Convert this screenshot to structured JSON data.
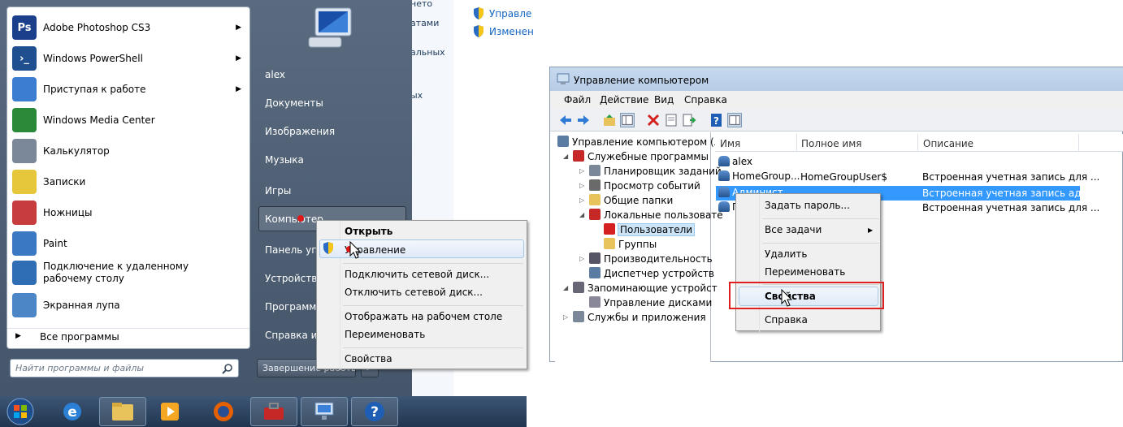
{
  "background_window": {
    "fragments": [
      "нето",
      "атами",
      "альных",
      "ых"
    ],
    "links": [
      "Управле",
      "Изменен"
    ]
  },
  "start_menu": {
    "programs": [
      {
        "label": "Adobe Photoshop CS3",
        "icon": "photoshop-icon",
        "has_submenu": true
      },
      {
        "label": "Windows PowerShell",
        "icon": "powershell-icon",
        "has_submenu": true
      },
      {
        "label": "Приступая к работе",
        "icon": "getting-started-icon",
        "has_submenu": true
      },
      {
        "label": "Windows Media Center",
        "icon": "media-center-icon",
        "has_submenu": false
      },
      {
        "label": "Калькулятор",
        "icon": "calculator-icon",
        "has_submenu": false
      },
      {
        "label": "Записки",
        "icon": "sticky-notes-icon",
        "has_submenu": false
      },
      {
        "label": "Ножницы",
        "icon": "snipping-tool-icon",
        "has_submenu": false
      },
      {
        "label": "Paint",
        "icon": "paint-icon",
        "has_submenu": false
      },
      {
        "label": "Подключение к удаленному рабочему столу",
        "icon": "remote-desktop-icon",
        "has_submenu": false
      },
      {
        "label": "Экранная лупа",
        "icon": "magnifier-icon",
        "has_submenu": false
      }
    ],
    "all_programs": "Все программы",
    "search_placeholder": "Найти программы и файлы",
    "right_items": [
      "alex",
      "Документы",
      "Изображения",
      "Музыка",
      "Игры",
      "Компьютер",
      "Панель упр",
      "Устройства",
      "Программы",
      "Справка и п"
    ],
    "shutdown": "Завершение работы"
  },
  "context_menu_computer": {
    "items": [
      "Открыть",
      "Управление",
      "Подключить сетевой диск...",
      "Отключить сетевой диск...",
      "Отображать на рабочем столе",
      "Переименовать",
      "Свойства"
    ],
    "highlighted": "Управление"
  },
  "taskbar": {
    "icons": [
      "start-orb-icon",
      "internet-explorer-icon",
      "explorer-folder-icon",
      "media-player-icon",
      "firefox-icon",
      "toolbox-icon",
      "network-computer-icon",
      "help-icon"
    ]
  },
  "computer_management": {
    "title": "Управление компьютером",
    "menu": [
      "Файл",
      "Действие",
      "Вид",
      "Справка"
    ],
    "tree": [
      "Управление компьютером (л",
      "Служебные программы",
      "Планировщик заданий",
      "Просмотр событий",
      "Общие папки",
      "Локальные пользовате",
      "Пользователи",
      "Группы",
      "Производительность",
      "Диспетчер устройств",
      "Запоминающие устройст",
      "Управление дисками",
      "Службы и приложения"
    ],
    "columns": [
      "Имя",
      "Полное имя",
      "Описание"
    ],
    "rows": [
      {
        "name": "alex",
        "fullname": "",
        "desc": ""
      },
      {
        "name": "HomeGroup...",
        "fullname": "HomeGroupUser$",
        "desc": "Встроенная учетная запись для ..."
      },
      {
        "name": "Админист...",
        "fullname": "",
        "desc": "Встроенная учетная запись адм..."
      },
      {
        "name": "Г",
        "fullname": "",
        "desc": "Встроенная учетная запись для ..."
      }
    ]
  },
  "context_menu_user": {
    "items": [
      "Задать пароль...",
      "Все задачи",
      "Удалить",
      "Переименовать",
      "Свойства",
      "Справка"
    ],
    "highlighted": "Свойства"
  },
  "colors": {
    "accent": "#3399ff",
    "highlight_box": "#e02020",
    "start_menu_bg": "#4f6075"
  }
}
